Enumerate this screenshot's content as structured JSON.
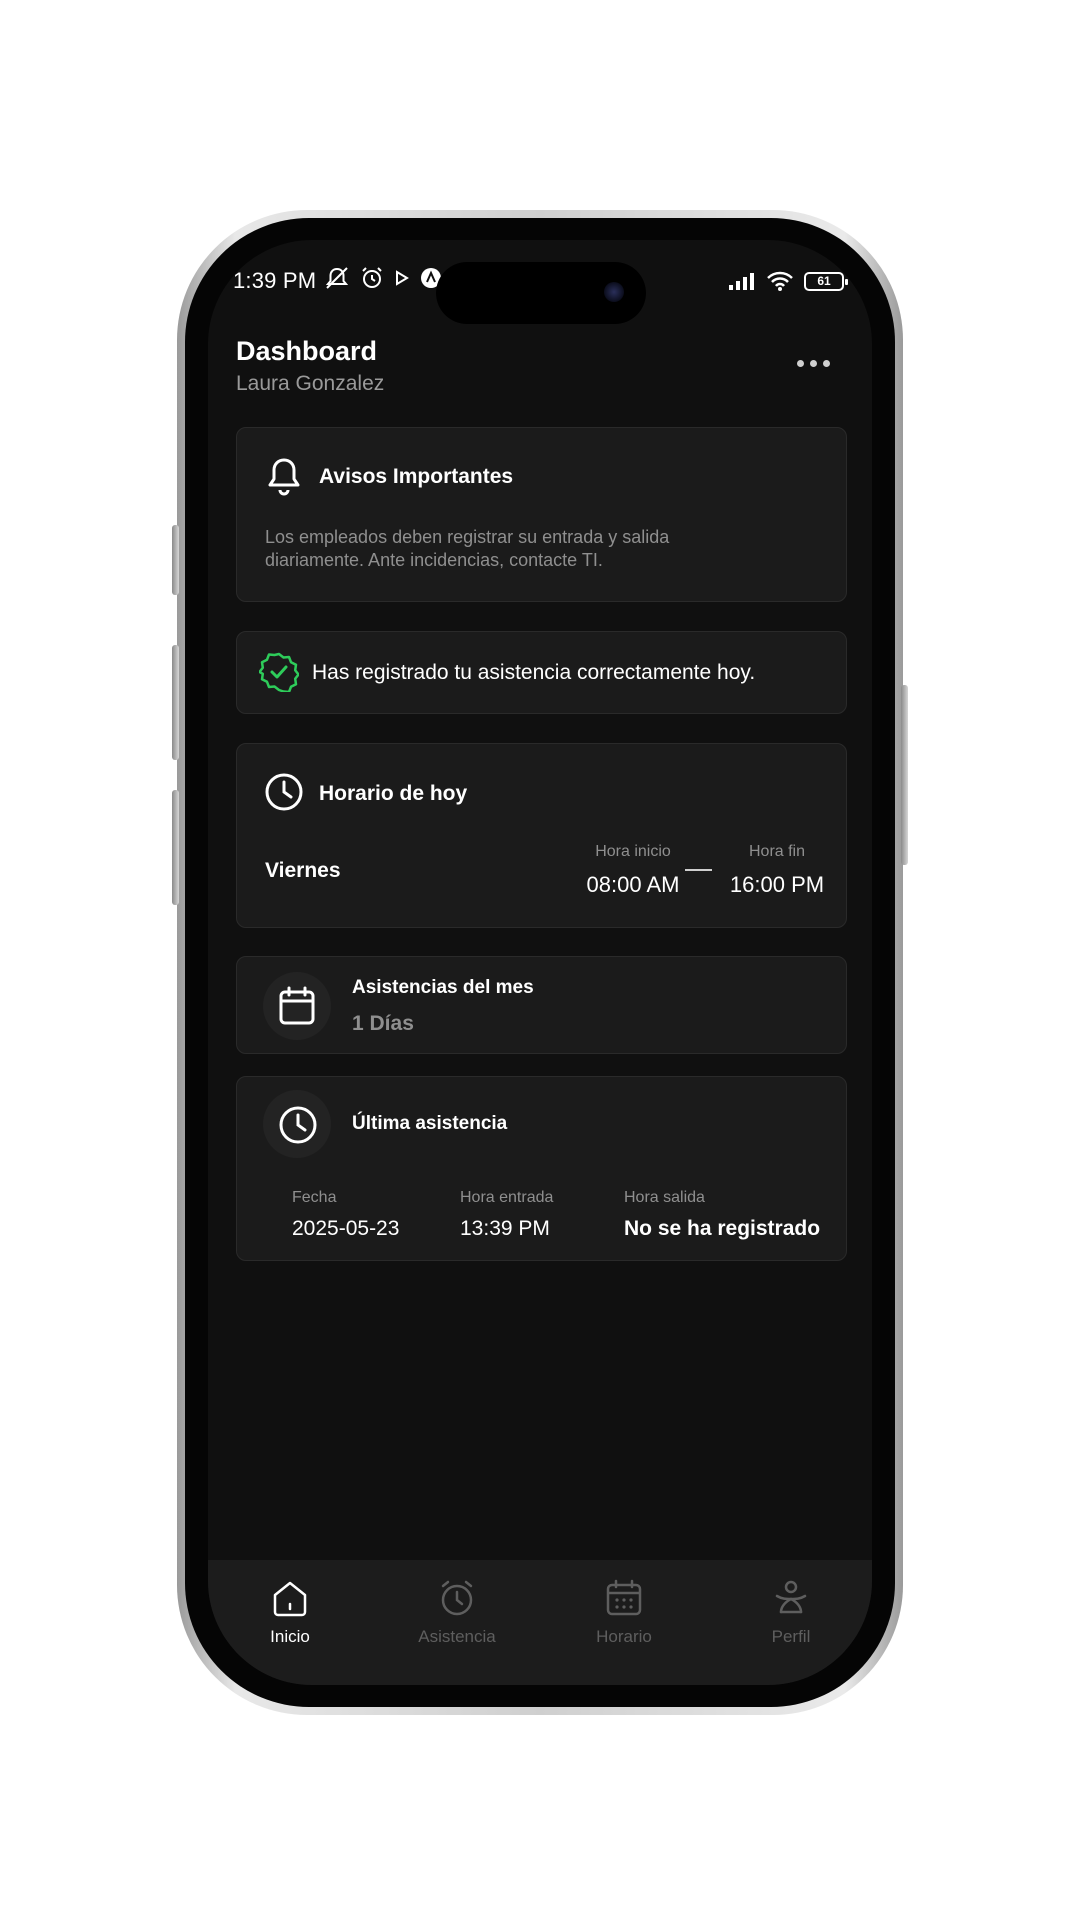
{
  "status_bar": {
    "time": "1:39 PM",
    "battery": "61"
  },
  "header": {
    "title": "Dashboard",
    "user_name": "Laura Gonzalez"
  },
  "notice": {
    "title": "Avisos Importantes",
    "text": "Los empleados deben registrar su entrada y salida diariamente. Ante incidencias, contacte TI."
  },
  "attendance_status": {
    "message": "Has registrado tu asistencia correctamente hoy.",
    "color": "#2ecc5a"
  },
  "schedule": {
    "title": "Horario de hoy",
    "day": "Viernes",
    "start_label": "Hora inicio",
    "start_time": "08:00 AM",
    "end_label": "Hora fin",
    "end_time": "16:00 PM"
  },
  "monthly": {
    "title": "Asistencias del mes",
    "value": "1 Días"
  },
  "last_attendance": {
    "title": "Última asistencia",
    "date_label": "Fecha",
    "date": "2025-05-23",
    "in_label": "Hora entrada",
    "in_time": "13:39 PM",
    "out_label": "Hora salida",
    "out_time": "No se ha registrado"
  },
  "nav": {
    "items": [
      {
        "label": "Inicio",
        "icon": "home-icon",
        "active": true
      },
      {
        "label": "Asistencia",
        "icon": "alarm-clock-icon",
        "active": false
      },
      {
        "label": "Horario",
        "icon": "calendar-icon",
        "active": false
      },
      {
        "label": "Perfil",
        "icon": "person-icon",
        "active": false
      }
    ]
  }
}
